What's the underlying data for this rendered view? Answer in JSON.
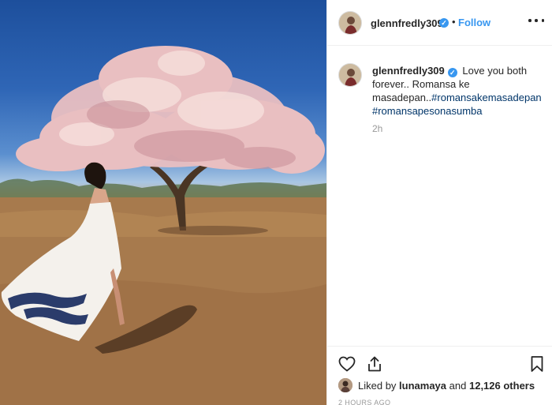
{
  "post": {
    "image_alt": "Woman in a white dress standing beside a blossoming pink tree in a dry field"
  },
  "header": {
    "username": "glennfredly309",
    "verified_glyph": "✓",
    "separator": "•",
    "follow_label": "Follow"
  },
  "caption": {
    "username": "glennfredly309",
    "verified_glyph": "✓",
    "text": "Love you both forever.. Romansa ke masadepan..",
    "hashtag1": "#romansakemasadepan",
    "hashtag2": "#romansapesonasumba",
    "time": "2h"
  },
  "actions": {
    "like_icon": "heart-icon",
    "share_icon": "share-icon",
    "save_icon": "bookmark-icon"
  },
  "likes": {
    "prefix": "Liked by",
    "user": "lunamaya",
    "joiner": "and",
    "others": "12,126 others"
  },
  "posted_ago": "2 HOURS AGO",
  "colors": {
    "accent": "#3897f0",
    "hashtag": "#003569",
    "muted": "#999999"
  }
}
